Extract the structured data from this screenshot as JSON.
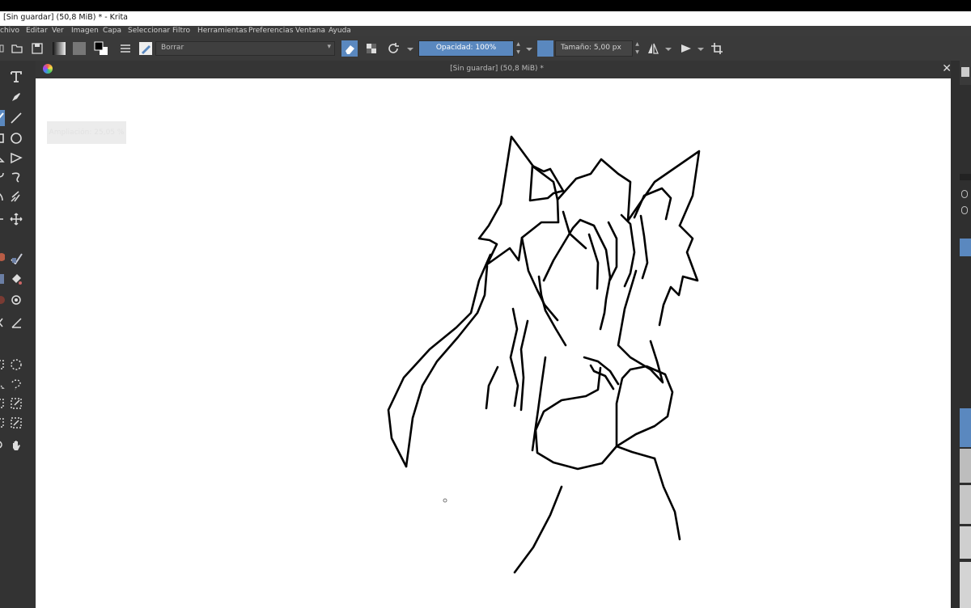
{
  "window": {
    "title": "[Sin guardar]  (50,8 MiB) * - Krita"
  },
  "menu": [
    "chivo",
    "Editar",
    "Ver",
    "Imagen",
    "Capa",
    "Seleccionar",
    "Filtro",
    "Herramientas",
    "Preferencias",
    "Ventana",
    "Ayuda"
  ],
  "toolbar": {
    "brush_preset": "Borrar",
    "opacity": "Opacidad: 100%",
    "size": "Tamaño: 5,00 px"
  },
  "document": {
    "tab_title": "[Sin guardar]  (50,8 MiB) *",
    "close_glyph": "✕"
  },
  "canvas": {
    "overlay_text": "Ampliación: 25,05 %"
  },
  "colors": {
    "accent": "#5a88bf",
    "canvas": "#ffffff",
    "chrome": "#3a3a3a"
  }
}
